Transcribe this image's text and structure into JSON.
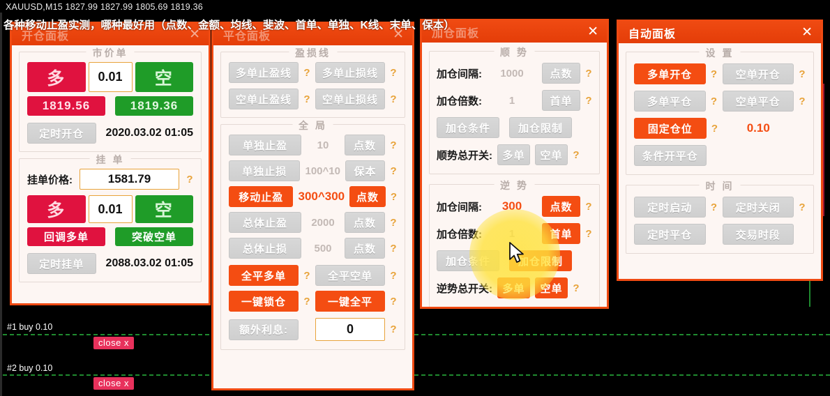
{
  "chart": {
    "header": "XAUUSD,M15  1827.99 1827.99 1805.69 1819.36",
    "overlay_title": "各种移动止盈实测，哪种最好用（点数、金额、均线、斐波、首单、单独、K线、末单、保本）",
    "trades": [
      {
        "label": "#1 buy 0.10",
        "close_label": "close x"
      },
      {
        "label": "#2 buy 0.10",
        "close_label": "close x"
      }
    ]
  },
  "colors": {
    "accent": "#ef4a12",
    "orange_btn": "#f44d12",
    "red_btn": "#e0123f",
    "green_btn": "#1f9c28",
    "grey_btn": "#d4d4d4",
    "question": "#e8a33a"
  },
  "panels": {
    "open": {
      "title": "开仓面板",
      "close": "✕",
      "market": {
        "legend": "市价单",
        "buy_label": "多",
        "sell_label": "空",
        "lot": "0.01",
        "buy_price": "1819.56",
        "sell_price": "1819.36",
        "timer_label": "定时开仓",
        "timer_value": "2020.03.02 01:05"
      },
      "pending": {
        "legend": "挂 单",
        "price_label": "挂单价格:",
        "price_value": "1581.79",
        "help": "?",
        "buy_label": "多",
        "sell_label": "空",
        "lot": "0.01",
        "buy_sub": "回调多单",
        "sell_sub": "突破空单",
        "timer_label": "定时挂单",
        "timer_value": "2088.03.02 01:05"
      }
    },
    "close": {
      "title": "平仓面板",
      "close": "✕",
      "pl_lines": {
        "legend": "盈损线",
        "buttons": [
          {
            "label": "多单止盈线",
            "state": "grey",
            "help": "?"
          },
          {
            "label": "多单止损线",
            "state": "grey",
            "help": "?"
          },
          {
            "label": "空单止盈线",
            "state": "grey",
            "help": "?"
          },
          {
            "label": "空单止损线",
            "state": "grey",
            "help": "?"
          }
        ]
      },
      "global": {
        "legend": "全 局",
        "rows": [
          {
            "left": "单独止盈",
            "left_state": "grey",
            "value": "10",
            "value_state": "grey",
            "right": "点数",
            "right_state": "grey",
            "help": "?"
          },
          {
            "left": "单独止损",
            "left_state": "grey",
            "value": "100^10",
            "value_state": "grey",
            "right": "保本",
            "right_state": "grey",
            "help": "?"
          },
          {
            "left": "移动止盈",
            "left_state": "orange",
            "value": "300^300",
            "value_state": "orange",
            "right": "点数",
            "right_state": "orange",
            "help": "?"
          },
          {
            "left": "总体止盈",
            "left_state": "grey",
            "value": "2000",
            "value_state": "grey",
            "right": "点数",
            "right_state": "grey",
            "help": "?"
          },
          {
            "left": "总体止损",
            "left_state": "grey",
            "value": "500",
            "value_state": "grey",
            "right": "点数",
            "right_state": "grey",
            "help": "?"
          }
        ],
        "pairs": [
          {
            "left": "全平多单",
            "left_state": "orange",
            "left_help": "?",
            "right": "全平空单",
            "right_state": "grey",
            "right_help": "?"
          },
          {
            "left": "一键锁仓",
            "left_state": "orange",
            "left_help": "?",
            "right": "一键全平",
            "right_state": "orange",
            "right_help": "?"
          }
        ],
        "interest_label": "额外利息:",
        "interest_value": "0",
        "interest_help": "?"
      }
    },
    "addpos": {
      "title": "加仓面板",
      "close": "✕",
      "trend": {
        "legend": "顺 势",
        "interval_label": "加仓间隔:",
        "interval_value": "1000",
        "interval_value_state": "grey",
        "interval_btn": "点数",
        "interval_btn_state": "grey",
        "interval_help": "?",
        "multi_label": "加仓倍数:",
        "multi_value": "1",
        "multi_value_state": "grey",
        "multi_btn": "首单",
        "multi_btn_state": "grey",
        "multi_help": "?",
        "cond_btn": "加仓条件",
        "cond_btn_state": "grey",
        "limit_btn": "加仓限制",
        "limit_btn_state": "grey",
        "switch_label": "顺势总开关:",
        "switch_buy": "多单",
        "switch_buy_state": "grey",
        "switch_sell": "空单",
        "switch_sell_state": "grey",
        "switch_help": "?"
      },
      "counter": {
        "legend": "逆 势",
        "interval_label": "加仓间隔:",
        "interval_value": "300",
        "interval_value_state": "orange",
        "interval_btn": "点数",
        "interval_btn_state": "orange",
        "interval_help": "?",
        "multi_label": "加仓倍数:",
        "multi_value": "1",
        "multi_value_state": "grey",
        "multi_btn": "首单",
        "multi_btn_state": "orange",
        "multi_help": "?",
        "cond_btn": "加仓条件",
        "cond_btn_state": "grey",
        "limit_btn": "加仓限制",
        "limit_btn_state": "orange",
        "switch_label": "逆势总开关:",
        "switch_buy": "多单",
        "switch_buy_state": "orange",
        "switch_sell": "空单",
        "switch_sell_state": "orange",
        "switch_help": "?"
      }
    },
    "auto": {
      "title": "自动面板",
      "close": "✕",
      "settings": {
        "legend": "设 置",
        "rows": [
          {
            "left": "多单开仓",
            "left_state": "orange",
            "left_help": "?",
            "right": "空单开仓",
            "right_state": "grey",
            "right_help": "?"
          },
          {
            "left": "多单平仓",
            "left_state": "grey",
            "left_help": "?",
            "right": "空单平仓",
            "right_state": "grey",
            "right_help": "?"
          }
        ],
        "fixed_label": "固定仓位",
        "fixed_state": "orange",
        "fixed_help": "?",
        "fixed_value": "0.10",
        "cond_label": "条件开平仓",
        "cond_state": "grey"
      },
      "time": {
        "legend": "时 间",
        "rows": [
          {
            "left": "定时启动",
            "left_state": "grey",
            "left_help": "?",
            "right": "定时关闭",
            "right_state": "grey",
            "right_help": "?"
          },
          {
            "left": "定时平仓",
            "left_state": "grey",
            "left_help": "",
            "right": "交易时段",
            "right_state": "grey",
            "right_help": ""
          }
        ]
      }
    }
  }
}
